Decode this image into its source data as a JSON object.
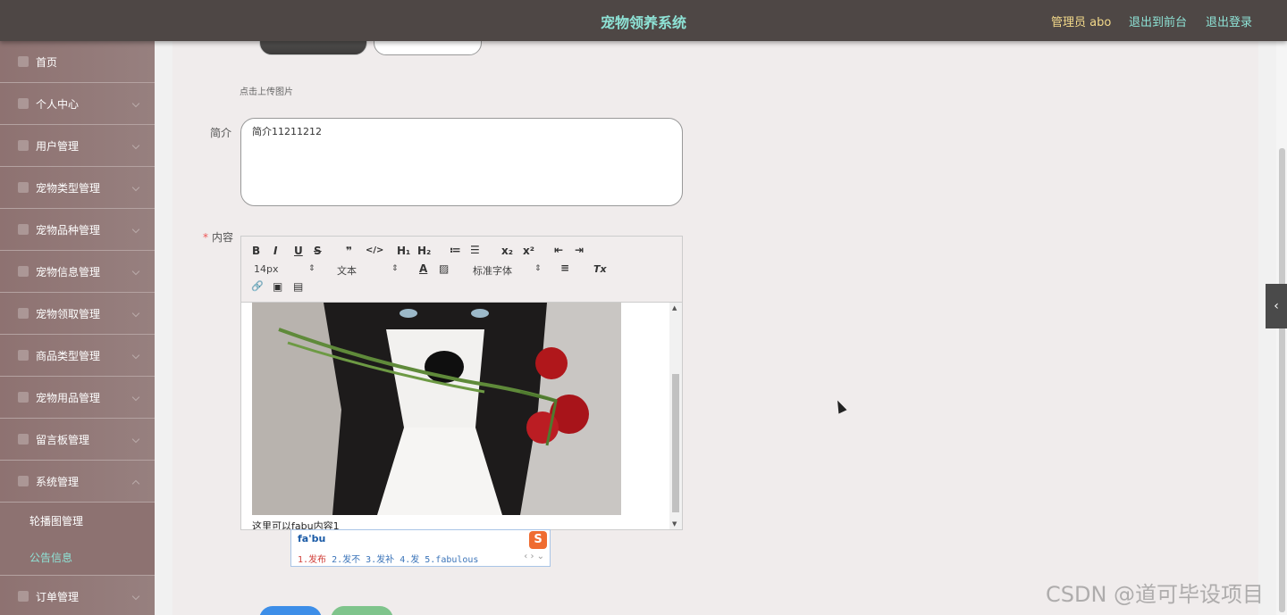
{
  "header": {
    "title": "宠物领养系统",
    "admin_label": "管理员 abo",
    "back_to_front": "退出到前台",
    "logout": "退出登录"
  },
  "sidebar": {
    "items": [
      {
        "label": "首页",
        "icon": "home-icon"
      },
      {
        "label": "个人中心",
        "icon": "user-icon"
      },
      {
        "label": "用户管理",
        "icon": "users-icon"
      },
      {
        "label": "宠物类型管理",
        "icon": "category-icon"
      },
      {
        "label": "宠物品种管理",
        "icon": "breed-icon"
      },
      {
        "label": "宠物信息管理",
        "icon": "pet-info-icon"
      },
      {
        "label": "宠物领取管理",
        "icon": "adopt-icon"
      },
      {
        "label": "商品类型管理",
        "icon": "goods-type-icon"
      },
      {
        "label": "宠物用品管理",
        "icon": "supplies-icon"
      },
      {
        "label": "留言板管理",
        "icon": "message-icon"
      },
      {
        "label": "系统管理",
        "icon": "settings-icon"
      }
    ],
    "sub_items": [
      {
        "label": "轮播图管理"
      },
      {
        "label": "公告信息"
      }
    ],
    "last_item": {
      "label": "订单管理",
      "icon": "order-icon"
    }
  },
  "form": {
    "upload_hint": "点击上传图片",
    "intro_label": "简介",
    "intro_value": "简介11211212",
    "content_required": "*",
    "content_label": "内容",
    "editor_text": "这里可以fabu内容1"
  },
  "toolbar": {
    "bold": "B",
    "italic": "I",
    "underline": "U",
    "strike": "S",
    "quote": "❞",
    "code": "</>",
    "h1": "H₁",
    "h2": "H₂",
    "ordered_list": "≔",
    "bullet_list": "☰",
    "subscript": "x₂",
    "superscript": "x²",
    "outdent": "⇤",
    "indent": "⇥",
    "font_size": "14px",
    "text_style": "文本",
    "font_family": "标准字体",
    "align": "≡",
    "clear": "Tx",
    "link": "🔗",
    "image": "▣",
    "video": "▤",
    "color": "A",
    "bgcolor": "▨"
  },
  "ime": {
    "typed": "fa'bu",
    "candidates": "1.发布  2.发不  3.发补  4.发  5.fabulous",
    "first": "1.发布",
    "rest": "  2.发不  3.发补  4.发  5.fabulous",
    "logo": "S"
  },
  "watermark": "CSDN @道可毕设项目"
}
